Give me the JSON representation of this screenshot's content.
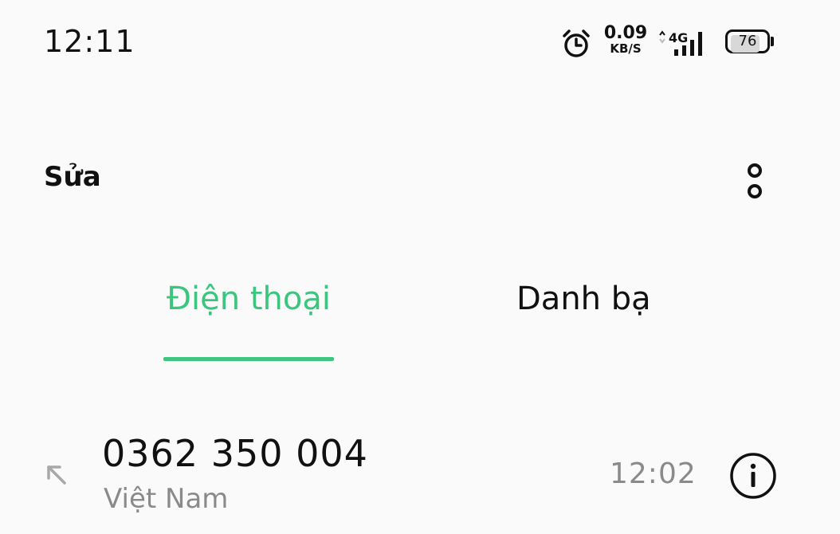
{
  "status_bar": {
    "time": "12:11",
    "net_speed_value": "0.09",
    "net_speed_unit": "KB/S",
    "network_type": "4G",
    "battery_level": "76",
    "icons": [
      "alarm-icon",
      "data-transfer-icon",
      "signal-icon",
      "battery-icon"
    ]
  },
  "header": {
    "edit_label": "Sửa",
    "more_icon": "more-options-icon"
  },
  "tabs": [
    {
      "label": "Điện thoại",
      "active": true
    },
    {
      "label": "Danh bạ",
      "active": false
    }
  ],
  "call_log": [
    {
      "number": "0362 350 004",
      "location": "Việt Nam",
      "time": "12:02",
      "direction_icon": "outgoing-call-icon",
      "info_icon": "info-icon"
    }
  ],
  "colors": {
    "accent": "#3cc57e",
    "background": "#fafafa",
    "text_primary": "#111111",
    "text_secondary": "#8a8a8a"
  }
}
